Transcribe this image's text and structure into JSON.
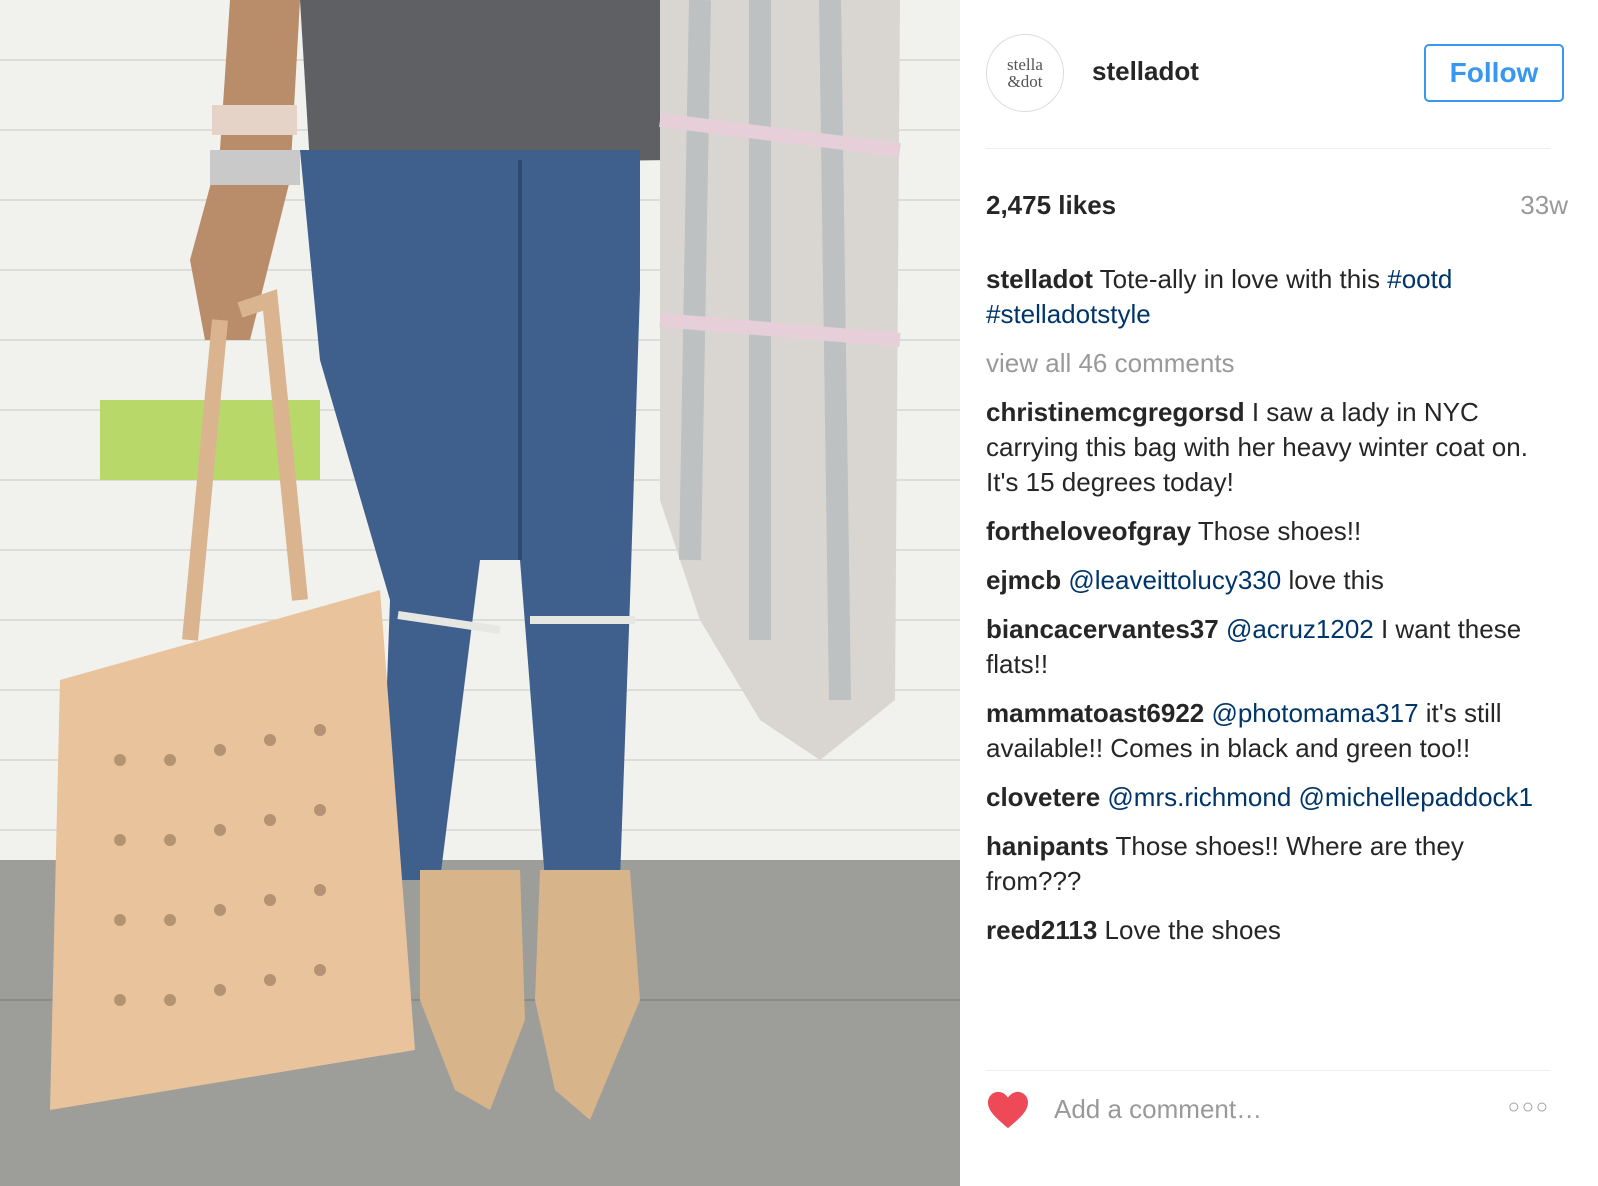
{
  "post": {
    "avatar": {
      "line1": "stella",
      "line2": "&dot"
    },
    "username": "stelladot",
    "follow_label": "Follow",
    "likes": "2,475 likes",
    "age": "33w",
    "caption": {
      "user": "stelladot",
      "text": " Tote-ally in love with this ",
      "tag1": "#ootd",
      "tag2": "#stelladotstyle"
    },
    "view_all": "view all 46 comments"
  },
  "comments": [
    {
      "user": "christinemcgregorsd",
      "parts": [
        {
          "t": " I saw a lady in NYC carrying this bag with her heavy winter coat on. It's 15 degrees today!"
        }
      ]
    },
    {
      "user": "fortheloveofgray",
      "parts": [
        {
          "t": " Those shoes!!"
        }
      ]
    },
    {
      "user": "ejmcb",
      "parts": [
        {
          "m": " @leaveittolucy330"
        },
        {
          "t": " love this"
        }
      ]
    },
    {
      "user": "biancacervantes37",
      "parts": [
        {
          "m": " @acruz1202"
        },
        {
          "t": " I want these flats!!"
        }
      ]
    },
    {
      "user": "mammatoast6922",
      "parts": [
        {
          "m": " @photomama317"
        },
        {
          "t": " it's still available!! Comes in black and green too!!"
        }
      ]
    },
    {
      "user": "clovetere",
      "parts": [
        {
          "m": " @mrs.richmond @michellepaddock1"
        }
      ]
    },
    {
      "user": "hanipants",
      "parts": [
        {
          "t": " Those shoes!! Where are they from???"
        }
      ]
    },
    {
      "user": "reed2113",
      "parts": [
        {
          "t": " Love the shoes"
        }
      ]
    }
  ],
  "footer": {
    "add_comment_placeholder": "Add a comment…",
    "more_icon": "○○○",
    "heart_icon": "heart-icon"
  },
  "colors": {
    "follow": "#3897f0",
    "mention": "#003569",
    "heart": "#ed4956",
    "muted": "#999999"
  }
}
